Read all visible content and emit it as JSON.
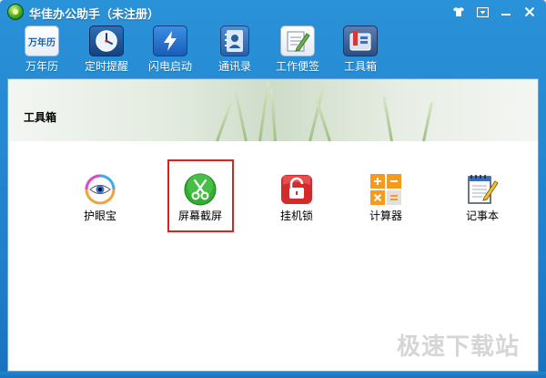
{
  "window": {
    "title": "华佳办公助手（未注册）",
    "controls": {
      "skin": "skin-icon",
      "menu": "menu-icon",
      "minimize": "minimize-icon",
      "close": "close-icon"
    }
  },
  "toolbar": {
    "items": [
      {
        "label": "万年历",
        "icon_text": "万年历",
        "icon": "calendar-icon"
      },
      {
        "label": "定时提醒",
        "icon": "clock-icon"
      },
      {
        "label": "闪电启动",
        "icon": "lightning-icon"
      },
      {
        "label": "通讯录",
        "icon": "contacts-icon"
      },
      {
        "label": "工作便签",
        "icon": "notepad-icon"
      },
      {
        "label": "工具箱",
        "icon": "toolbox-icon"
      }
    ]
  },
  "panel": {
    "section_title": "工具箱",
    "apps": [
      {
        "label": "护眼宝",
        "icon": "eye-icon"
      },
      {
        "label": "屏幕截屏",
        "icon": "scissors-icon"
      },
      {
        "label": "挂机锁",
        "icon": "lock-icon"
      },
      {
        "label": "计算器",
        "icon": "calculator-icon"
      },
      {
        "label": "记事本",
        "icon": "notebook-icon"
      }
    ]
  },
  "watermark": "极速下载站",
  "colors": {
    "titlebar": "#1f7fcc",
    "highlight_border": "#e02020",
    "panel_border": "#6aa9d8"
  }
}
